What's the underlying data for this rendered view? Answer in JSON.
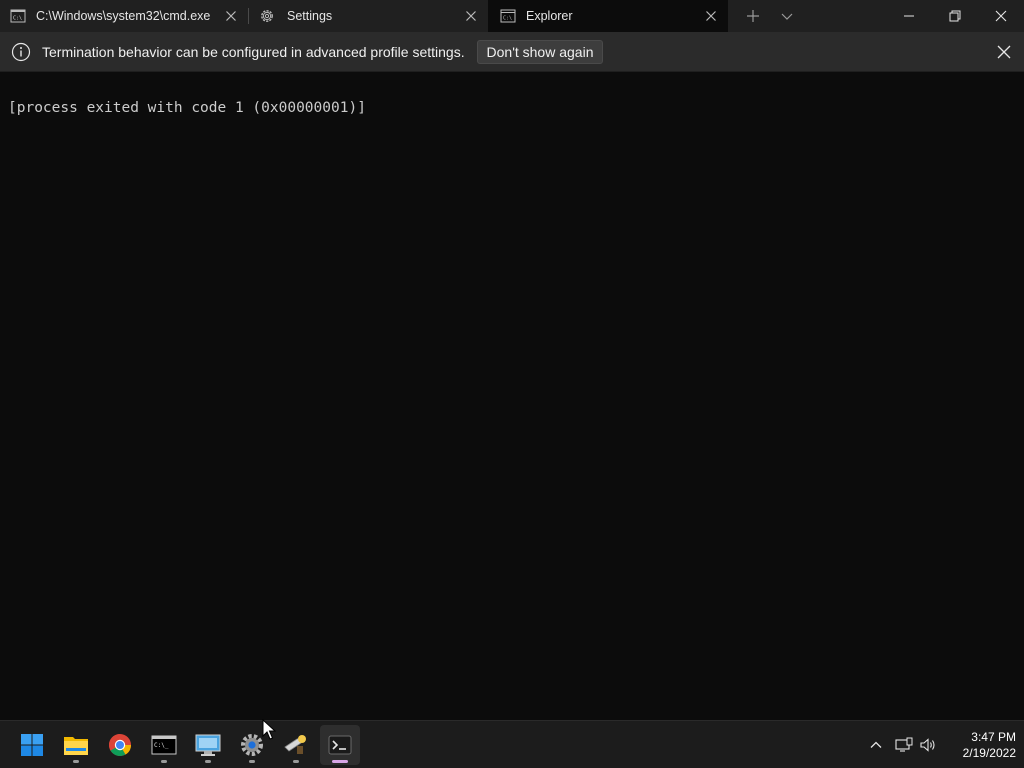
{
  "window": {
    "tabs": [
      {
        "title": "C:\\Windows\\system32\\cmd.exe",
        "icon": "cmd-icon"
      },
      {
        "title": "Settings",
        "icon": "gear-icon"
      },
      {
        "title": "Explorer",
        "icon": "cmd-icon",
        "active": true
      }
    ],
    "new_tab_icon": "plus-icon",
    "dropdown_icon": "chevron-down-icon",
    "controls": [
      "minimize-icon",
      "restore-icon",
      "close-icon"
    ]
  },
  "infobar": {
    "message": "Termination behavior can be configured in advanced profile settings.",
    "button_label": "Don't show again",
    "icon": "info-icon"
  },
  "terminal": {
    "lines": [
      "[process exited with code 1 (0x00000001)]"
    ],
    "foreground": "#cccccc",
    "background": "#0c0c0c"
  },
  "taskbar": {
    "apps": [
      "start-icon",
      "file-explorer-icon",
      "chrome-icon",
      "cmd-icon",
      "remote-desktop-icon",
      "settings-icon",
      "tools-icon",
      "terminal-icon"
    ],
    "tray": [
      "chevron-up-icon",
      "network-icon",
      "volume-icon"
    ],
    "time": "3:47 PM",
    "date": "2/19/2022",
    "accent": "#0078d4"
  }
}
